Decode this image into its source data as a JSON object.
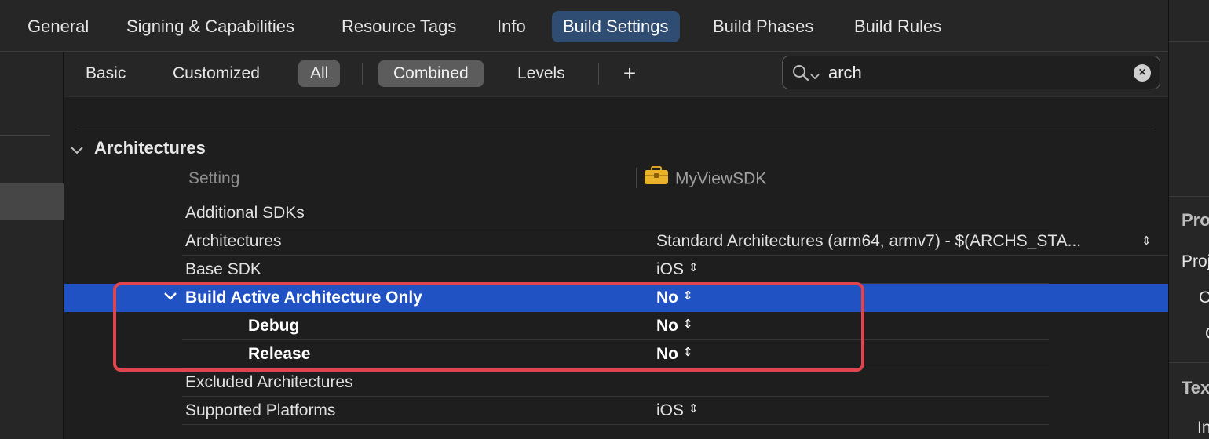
{
  "tabs": [
    {
      "label": "General",
      "active": false
    },
    {
      "label": "Signing & Capabilities",
      "active": false
    },
    {
      "label": "Resource Tags",
      "active": false
    },
    {
      "label": "Info",
      "active": false
    },
    {
      "label": "Build Settings",
      "active": true
    },
    {
      "label": "Build Phases",
      "active": false
    },
    {
      "label": "Build Rules",
      "active": false
    }
  ],
  "filter": {
    "basic": "Basic",
    "customized": "Customized",
    "all": "All",
    "combined": "Combined",
    "levels": "Levels",
    "add": "+",
    "search_value": "arch"
  },
  "section": {
    "title": "Architectures",
    "col_setting": "Setting",
    "col_target": "MyViewSDK"
  },
  "rows": [
    {
      "name": "Additional SDKs",
      "value": ""
    },
    {
      "name": "Architectures",
      "value": "Standard Architectures (arm64, armv7)  -  $(ARCHS_STA..."
    },
    {
      "name": "Base SDK",
      "value": "iOS"
    },
    {
      "name": "Build Active Architecture Only",
      "value": "No"
    },
    {
      "name": "Debug",
      "value": "No"
    },
    {
      "name": "Release",
      "value": "No"
    },
    {
      "name": "Excluded Architectures",
      "value": ""
    },
    {
      "name": "Supported Platforms",
      "value": "iOS"
    }
  ],
  "inspector": {
    "heading1": "Pro",
    "line1": "Proj",
    "line2": "O",
    "line3": "C",
    "heading2": "Tex",
    "line4": "In"
  },
  "colors": {
    "selection": "#2152c4",
    "active_tab": "#2f4d73",
    "highlight_box": "#e0444d"
  }
}
